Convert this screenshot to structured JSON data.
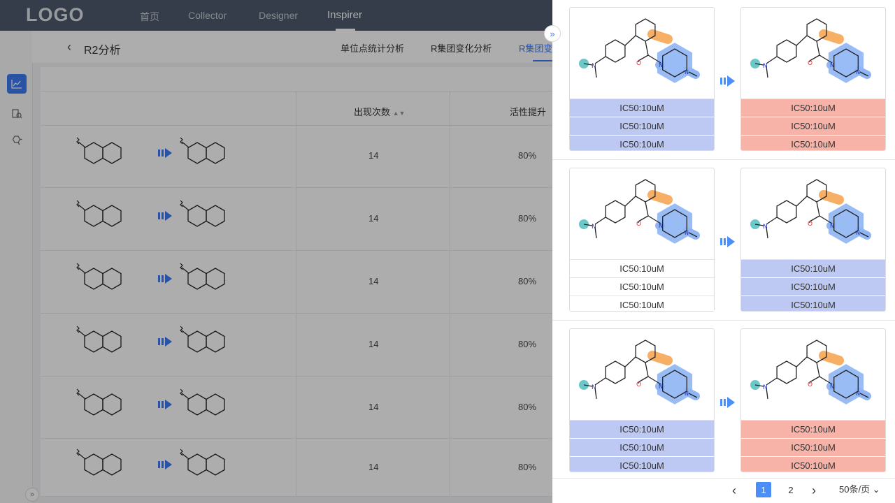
{
  "topnav": {
    "logo": "LOGO",
    "items": [
      "首页",
      "Collector",
      "Designer",
      "Inspirer"
    ],
    "active": "Inspirer"
  },
  "sidebar": {
    "icons": [
      "chart-icon",
      "molecule-search-icon",
      "molecule-icon"
    ],
    "expand_label": "»"
  },
  "page": {
    "back_label": "‹",
    "title": "R2分析",
    "tabs": [
      "单位点统计分析",
      "R集团变化分析",
      "R集团变"
    ]
  },
  "table": {
    "headers": {
      "count": "出现次数",
      "activity": "活性提升"
    },
    "sort_icon": "sort-icon",
    "rows": [
      {
        "count": "14",
        "activity": "80%"
      },
      {
        "count": "14",
        "activity": "80%"
      },
      {
        "count": "14",
        "activity": "80%"
      },
      {
        "count": "14",
        "activity": "80%"
      },
      {
        "count": "14",
        "activity": "80%"
      },
      {
        "count": "14",
        "activity": "80%"
      }
    ]
  },
  "panel": {
    "toggle_label": "»",
    "pairs": [
      {
        "left": {
          "style": "blue",
          "values": [
            "IC50:10uM",
            "IC50:10uM",
            "IC50:10uM"
          ]
        },
        "right": {
          "style": "red",
          "values": [
            "IC50:10uM",
            "IC50:10uM",
            "IC50:10uM"
          ]
        }
      },
      {
        "left": {
          "style": "white",
          "values": [
            "IC50:10uM",
            "IC50:10uM",
            "IC50:10uM"
          ]
        },
        "right": {
          "style": "blue",
          "values": [
            "IC50:10uM",
            "IC50:10uM",
            "IC50:10uM"
          ]
        }
      },
      {
        "left": {
          "style": "blue",
          "values": [
            "IC50:10uM",
            "IC50:10uM",
            "IC50:10uM"
          ]
        },
        "right": {
          "style": "red",
          "values": [
            "IC50:10uM",
            "IC50:10uM",
            "IC50:10uM"
          ]
        }
      }
    ],
    "pagination": {
      "prev": "‹",
      "pages": [
        "1",
        "2"
      ],
      "current": "1",
      "next": "›",
      "page_size": "50条/页"
    }
  },
  "colors": {
    "accent": "#3d7bf5",
    "blue_value": "#bdc9f3",
    "red_value": "#f7b3a8",
    "highlight_orange": "#f6a24b",
    "highlight_blue": "#8fb5f5",
    "highlight_teal": "#6cc7c9"
  }
}
